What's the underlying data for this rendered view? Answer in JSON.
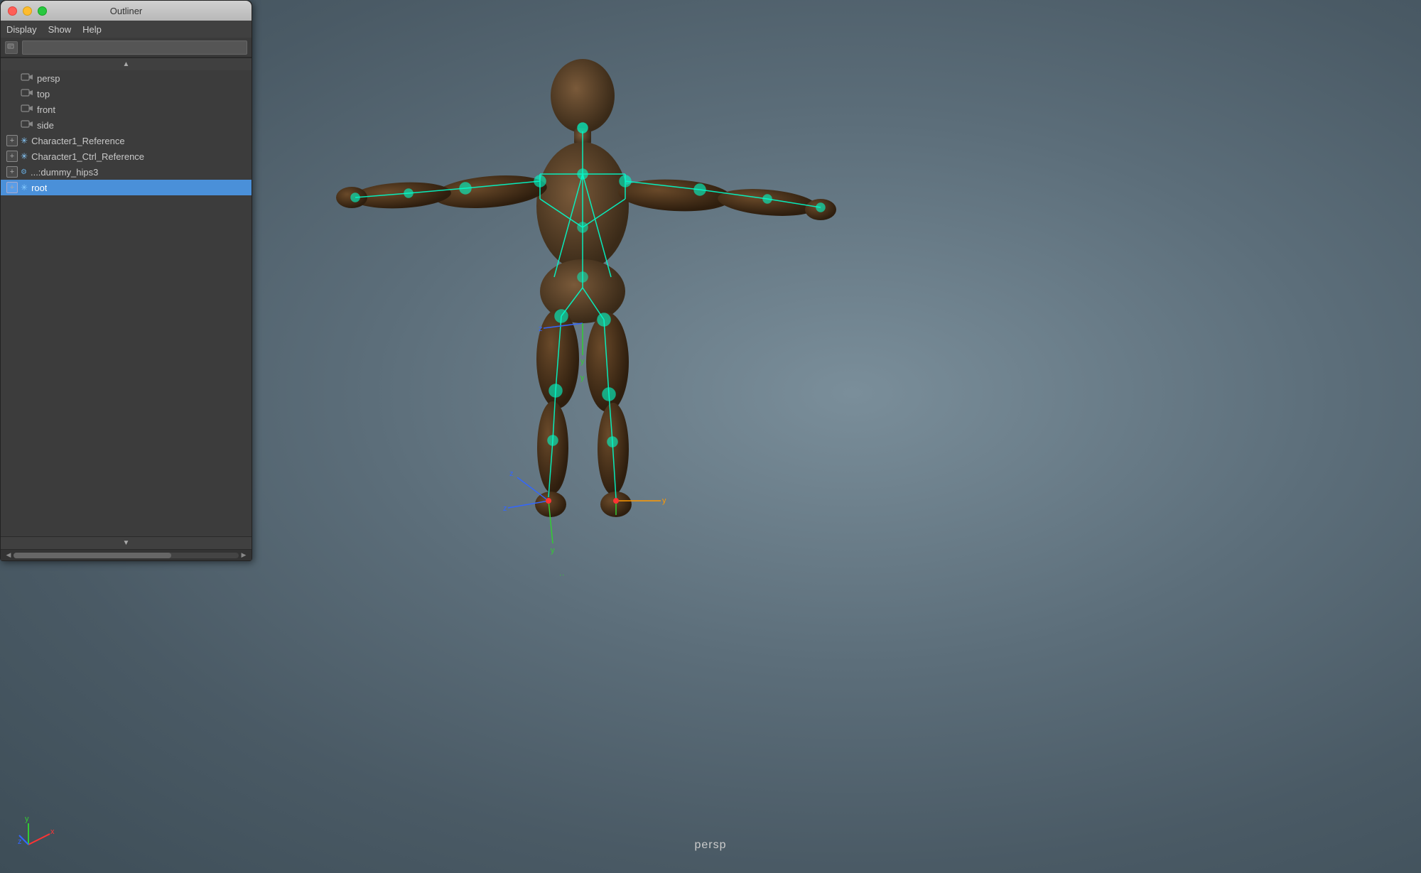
{
  "app": {
    "title": "Outliner",
    "background_color": "#5c6e7a"
  },
  "title_bar": {
    "title": "Outliner",
    "traffic_lights": [
      "red",
      "yellow",
      "green"
    ]
  },
  "menu_bar": {
    "items": [
      {
        "label": "Display"
      },
      {
        "label": "Show"
      },
      {
        "label": "Help"
      }
    ]
  },
  "search_bar": {
    "placeholder": ""
  },
  "tree": {
    "items": [
      {
        "id": "persp",
        "type": "camera",
        "label": "persp",
        "expandable": false,
        "selected": false
      },
      {
        "id": "top",
        "type": "camera",
        "label": "top",
        "expandable": false,
        "selected": false
      },
      {
        "id": "front",
        "type": "camera",
        "label": "front",
        "expandable": false,
        "selected": false
      },
      {
        "id": "side",
        "type": "camera",
        "label": "side",
        "expandable": false,
        "selected": false
      },
      {
        "id": "char1ref",
        "type": "reference",
        "label": "Character1_Reference",
        "expandable": true,
        "selected": false
      },
      {
        "id": "char1ctrl",
        "type": "reference",
        "label": "Character1_Ctrl_Reference",
        "expandable": true,
        "selected": false
      },
      {
        "id": "dummyhips",
        "type": "dots",
        "label": "...:dummy_hips3",
        "expandable": true,
        "selected": false
      },
      {
        "id": "root",
        "type": "root",
        "label": "root",
        "expandable": true,
        "selected": true
      }
    ]
  },
  "viewport": {
    "label": "persp",
    "axis_labels": {
      "x": "x",
      "y": "y",
      "z": "z"
    }
  },
  "axis_indicator": {
    "x_color": "#ff3333",
    "y_color": "#33cc33",
    "z_color": "#3366ff"
  },
  "skeleton_color": "#00ffcc"
}
